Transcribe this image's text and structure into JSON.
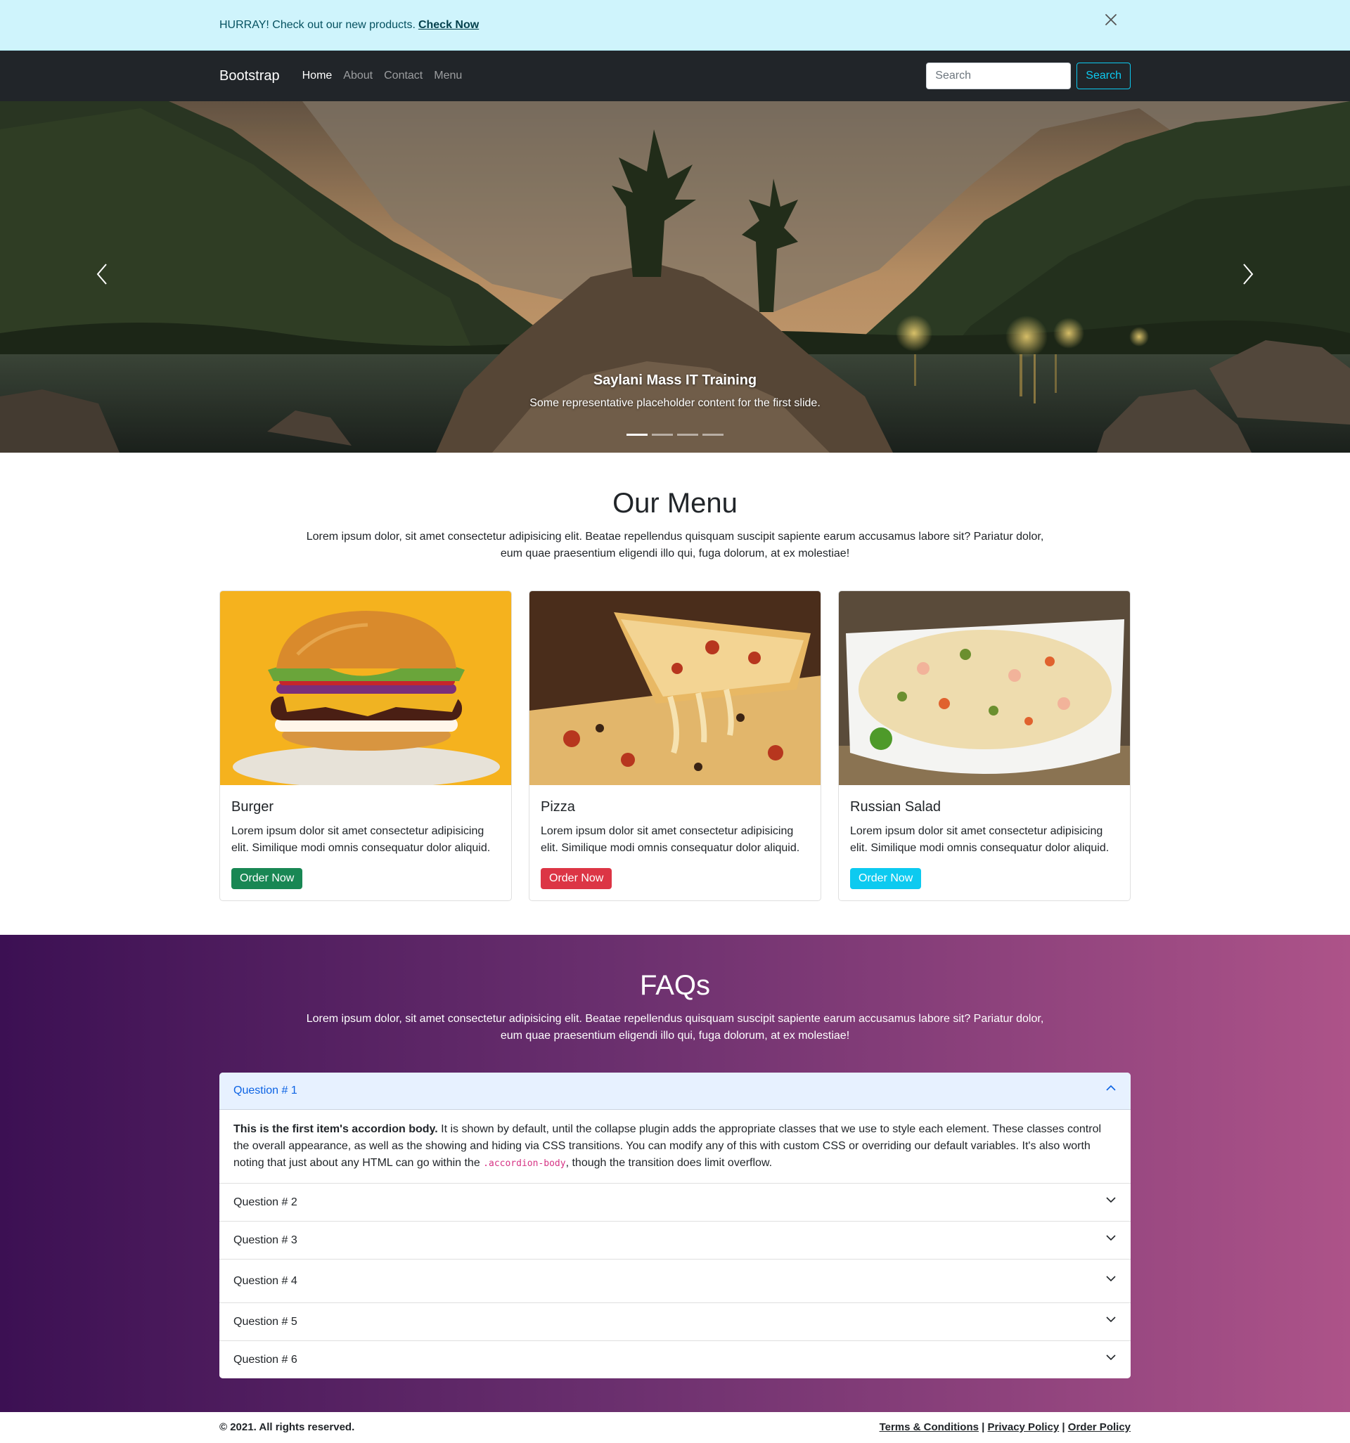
{
  "alert": {
    "text": "HURRAY! Check out our new products.",
    "link": "Check Now"
  },
  "navbar": {
    "brand": "Bootstrap",
    "links": [
      "Home",
      "About",
      "Contact",
      "Menu"
    ],
    "active": "Home",
    "search_placeholder": "Search",
    "search_button": "Search"
  },
  "carousel": {
    "caption_title": "Saylani Mass IT Training",
    "caption_text": "Some representative placeholder content for the first slide.",
    "slide_count": 4,
    "active_slide": 1
  },
  "menu": {
    "title": "Our Menu",
    "lead": "Lorem ipsum dolor, sit amet consectetur adipisicing elit. Beatae repellendus quisquam suscipit sapiente earum accusamus labore sit? Pariatur dolor, eum quae praesentium eligendi illo qui, fuga dolorum, at ex molestiae!",
    "cards": [
      {
        "title": "Burger",
        "text": "Lorem ipsum dolor sit amet consectetur adipisicing elit. Similique modi omnis consequatur dolor aliquid.",
        "button": "Order Now",
        "button_color": "#198754"
      },
      {
        "title": "Pizza",
        "text": "Lorem ipsum dolor sit amet consectetur adipisicing elit. Similique modi omnis consequatur dolor aliquid.",
        "button": "Order Now",
        "button_color": "#dc3545"
      },
      {
        "title": "Russian Salad",
        "text": "Lorem ipsum dolor sit amet consectetur adipisicing elit. Similique modi omnis consequatur dolor aliquid.",
        "button": "Order Now",
        "button_color": "#0dcaf0"
      }
    ]
  },
  "faq": {
    "title": "FAQs",
    "lead": "Lorem ipsum dolor, sit amet consectetur adipisicing elit. Beatae repellendus quisquam suscipit sapiente earum accusamus labore sit? Pariatur dolor, eum quae praesentium eligendi illo qui, fuga dolorum, at ex molestiae!",
    "questions": [
      "Question # 1",
      "Question # 2",
      "Question # 3",
      "Question # 4",
      "Question # 5",
      "Question # 6"
    ],
    "open_body": {
      "strong": "This is the first item's accordion body.",
      "text1": " It is shown by default, until the collapse plugin adds the appropriate classes that we use to style each element. These classes control the overall appearance, as well as the showing and hiding via CSS transitions. You can modify any of this with custom CSS or overriding our default variables. It's also worth noting that just about any HTML can go within the ",
      "code": ".accordion-body",
      "text2": ", though the transition does limit overflow."
    }
  },
  "footer": {
    "copyright": "© 2021. All rights reserved.",
    "links": [
      "Terms & Conditions",
      "Privacy Policy",
      "Order Policy"
    ],
    "separator": "|"
  },
  "colors": {
    "alert_bg": "#cff4fc",
    "navbar_bg": "#212529",
    "search_outline": "#0dcaf0",
    "accordion_open_bg": "#e7f1ff",
    "accordion_open_text": "#0c63e4",
    "faq_gradient_start": "#3c1053",
    "faq_gradient_end": "#ad5389"
  },
  "icons": {
    "alert_close": "close-icon",
    "carousel_prev": "chevron-left-icon",
    "carousel_next": "chevron-right-icon",
    "accordion_open": "chevron-up-icon",
    "accordion_closed": "chevron-down-icon"
  }
}
